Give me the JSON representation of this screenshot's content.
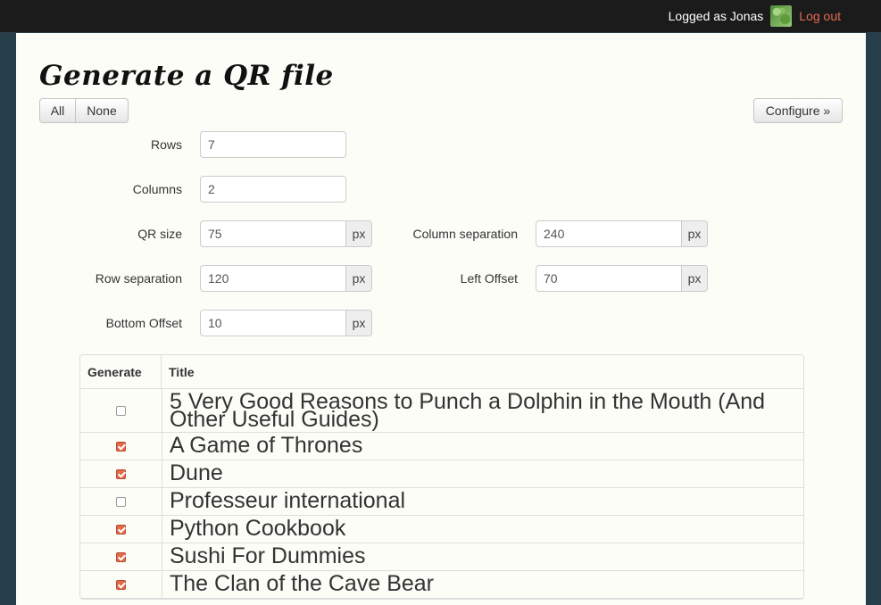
{
  "topbar": {
    "logged_text": "Logged as Jonas",
    "logout_label": "Log out"
  },
  "page": {
    "title": "Generate a QR file",
    "all_label": "All",
    "none_label": "None",
    "configure_label": "Configure »"
  },
  "form": {
    "rows": {
      "label": "Rows",
      "value": "7"
    },
    "columns": {
      "label": "Columns",
      "value": "2"
    },
    "qr_size": {
      "label": "QR size",
      "value": "75",
      "unit": "px"
    },
    "column_separation": {
      "label": "Column separation",
      "value": "240",
      "unit": "px"
    },
    "row_separation": {
      "label": "Row separation",
      "value": "120",
      "unit": "px"
    },
    "left_offset": {
      "label": "Left Offset",
      "value": "70",
      "unit": "px"
    },
    "bottom_offset": {
      "label": "Bottom Offset",
      "value": "10",
      "unit": "px"
    }
  },
  "table": {
    "headers": [
      "Generate",
      "Title"
    ],
    "rows": [
      {
        "title": "5 Very Good Reasons to Punch a Dolphin in the Mouth (And Other Useful Guides)",
        "checked": false
      },
      {
        "title": "A Game of Thrones",
        "checked": true
      },
      {
        "title": "Dune",
        "checked": true
      },
      {
        "title": "Professeur international",
        "checked": false
      },
      {
        "title": "Python Cookbook",
        "checked": true
      },
      {
        "title": "Sushi For Dummies",
        "checked": true
      },
      {
        "title": "The Clan of the Cave Bear",
        "checked": true
      }
    ]
  }
}
